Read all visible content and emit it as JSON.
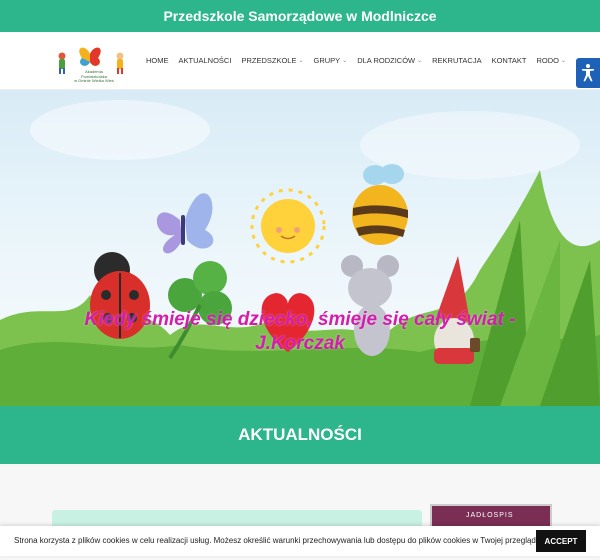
{
  "site": {
    "title": "Przedszkole Samorządowe w Modlniczce",
    "logo_text": [
      "Akademia Przedszkolaka",
      "w Gminie Wielka Wieś"
    ]
  },
  "nav": {
    "items": [
      {
        "label": "HOME",
        "dropdown": false
      },
      {
        "label": "AKTUALNOŚCI",
        "dropdown": false
      },
      {
        "label": "PRZEDSZKOLE",
        "dropdown": true
      },
      {
        "label": "GRUPY",
        "dropdown": true
      },
      {
        "label": "DLA RODZICÓW",
        "dropdown": true
      },
      {
        "label": "REKRUTACJA",
        "dropdown": false
      },
      {
        "label": "KONTAKT",
        "dropdown": false
      },
      {
        "label": "RODO",
        "dropdown": true
      }
    ],
    "chevron": "⌄"
  },
  "hero": {
    "quote": "Kiedy śmieje się dziecko, śmieje się cały świat - J.Korczak"
  },
  "section": {
    "title": "AKTUALNOŚCI"
  },
  "sidebar": {
    "thumb_label": "JADŁOSPIS"
  },
  "cookie": {
    "text": "Strona korzysta z plików cookies w celu realizacji usług. Możesz określić warunki przechowywania lub dostępu do plików cookies w Twojej przeglądarce.",
    "accept_label": "ACCEPT"
  },
  "colors": {
    "brand_green": "#2db68b",
    "quote_pink": "#d41dad",
    "accessibility_blue": "#1e62b8"
  },
  "icons": [
    "accessibility-icon",
    "chevron-down-icon"
  ]
}
